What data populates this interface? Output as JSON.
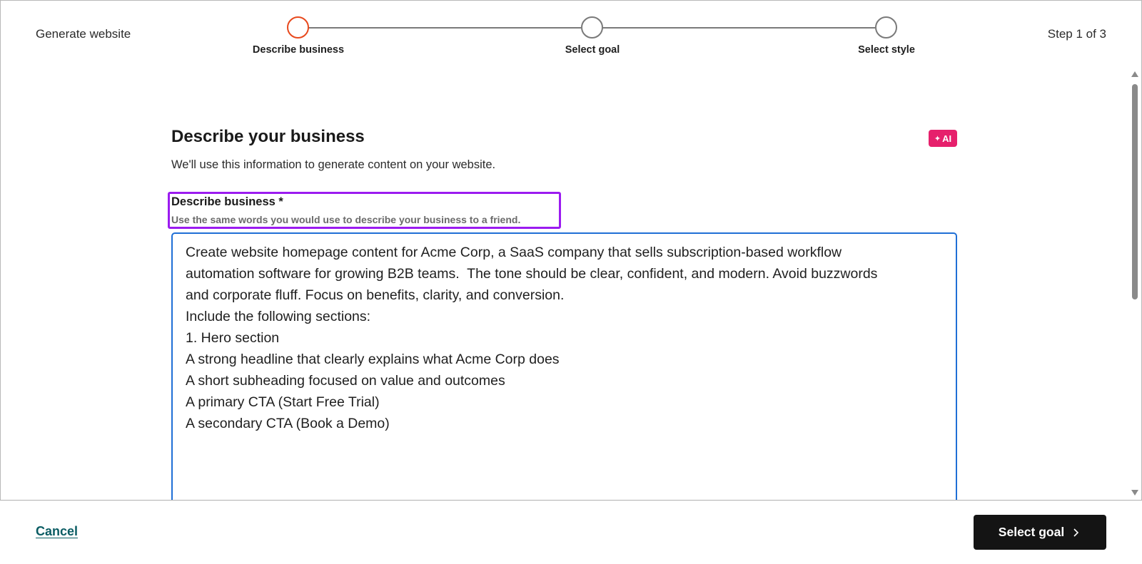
{
  "header": {
    "title": "Generate website",
    "step_count": "Step 1 of 3"
  },
  "stepper": {
    "steps": [
      {
        "label": "Describe business",
        "active": true
      },
      {
        "label": "Select goal",
        "active": false
      },
      {
        "label": "Select style",
        "active": false
      }
    ]
  },
  "main": {
    "title": "Describe your business",
    "ai_badge": "AI",
    "subtitle": "We'll use this information to generate content on your website.",
    "field": {
      "label": "Describe business *",
      "help": "Use the same words you would use to describe your business to a friend.",
      "value": "Create website homepage content for Acme Corp, a SaaS company that sells subscription-based workflow\nautomation software for growing B2B teams.  The tone should be clear, confident, and modern. Avoid buzzwords\nand corporate fluff. Focus on benefits, clarity, and conversion.\nInclude the following sections:\n1. Hero section\nA strong headline that clearly explains what Acme Corp does\nA short subheading focused on value and outcomes\nA primary CTA (Start Free Trial)\nA secondary CTA (Book a Demo)"
    }
  },
  "footer": {
    "cancel_label": "Cancel",
    "next_label": "Select goal"
  },
  "colors": {
    "active_step": "#e8491d",
    "ai_badge": "#e6206c",
    "annotation": "#9b1bf0",
    "focus_border": "#1f6fd6",
    "link": "#0a5c63"
  }
}
